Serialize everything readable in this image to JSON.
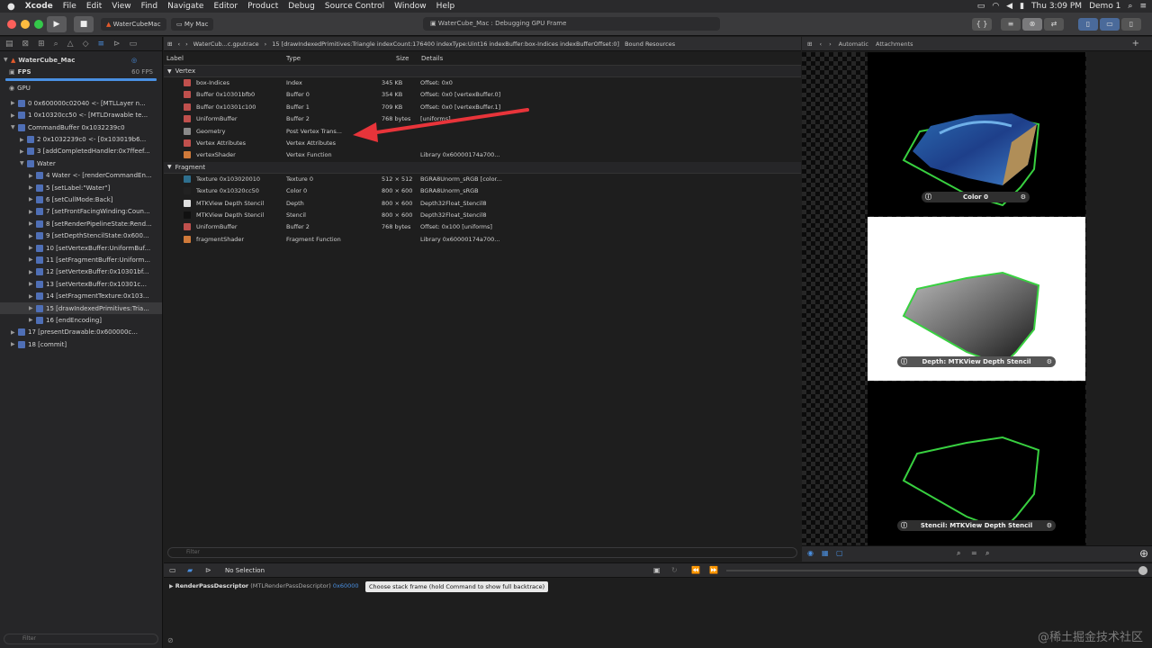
{
  "menubar": {
    "items": [
      "Xcode",
      "File",
      "Edit",
      "View",
      "Find",
      "Navigate",
      "Editor",
      "Product",
      "Debug",
      "Source Control",
      "Window",
      "Help"
    ],
    "clock": "Thu 3:09 PM",
    "user": "Demo 1"
  },
  "toolbar": {
    "scheme": "WaterCubeMac",
    "destination": "My Mac",
    "activity": "WaterCube_Mac : Debugging GPU Frame"
  },
  "navigator": {
    "project": "WaterCube_Mac",
    "fps_label": "FPS",
    "fps_value": "60 FPS",
    "gpu_label": "GPU",
    "filter_placeholder": "Filter",
    "items": [
      {
        "label": "0 0x600000c02040 <- [MTLLayer n...",
        "level": 1,
        "tri": "▶"
      },
      {
        "label": "1 0x10320cc50 <- [MTLDrawable te...",
        "level": 1,
        "tri": "▶"
      },
      {
        "label": "CommandBuffer 0x1032239c0",
        "level": 1,
        "tri": "▼"
      },
      {
        "label": "2 0x1032239c0 <- [0x103019b6...",
        "level": 2,
        "tri": "▶"
      },
      {
        "label": "3 [addCompletedHandler:0x7ffeef...",
        "level": 2,
        "tri": "▶"
      },
      {
        "label": "Water",
        "level": 2,
        "tri": "▼"
      },
      {
        "label": "4 Water <- [renderCommandEn...",
        "level": 3,
        "tri": "▶"
      },
      {
        "label": "5 [setLabel:\"Water\"]",
        "level": 3,
        "tri": "▶"
      },
      {
        "label": "6 [setCullMode:Back]",
        "level": 3,
        "tri": "▶"
      },
      {
        "label": "7 [setFrontFacingWinding:Coun...",
        "level": 3,
        "tri": "▶"
      },
      {
        "label": "8 [setRenderPipelineState:Rend...",
        "level": 3,
        "tri": "▶"
      },
      {
        "label": "9 [setDepthStencilState:0x600...",
        "level": 3,
        "tri": "▶"
      },
      {
        "label": "10 [setVertexBuffer:UniformBuf...",
        "level": 3,
        "tri": "▶"
      },
      {
        "label": "11 [setFragmentBuffer:Uniform...",
        "level": 3,
        "tri": "▶"
      },
      {
        "label": "12 [setVertexBuffer:0x10301bf...",
        "level": 3,
        "tri": "▶"
      },
      {
        "label": "13 [setVertexBuffer:0x10301c...",
        "level": 3,
        "tri": "▶"
      },
      {
        "label": "14 [setFragmentTexture:0x103...",
        "level": 3,
        "tri": "▶"
      },
      {
        "label": "15 [drawIndexedPrimitives:Tria...",
        "level": 3,
        "tri": "▶",
        "selected": true
      },
      {
        "label": "16 [endEncoding]",
        "level": 3,
        "tri": "▶"
      },
      {
        "label": "17 [presentDrawable:0x600000c...",
        "level": 1,
        "tri": "▶"
      },
      {
        "label": "18 [commit]",
        "level": 1,
        "tri": "▶"
      }
    ]
  },
  "jumpbar": {
    "file": "WaterCub...c.gputrace",
    "call": "15 [drawIndexedPrimitives:Triangle indexCount:176400 indexType:Uint16 indexBuffer:box-Indices indexBufferOffset:0]",
    "bound": "Bound Resources"
  },
  "table": {
    "headers": {
      "label": "Label",
      "type": "Type",
      "size": "Size",
      "details": "Details"
    },
    "vertex_section": "Vertex",
    "fragment_section": "Fragment",
    "vertex_rows": [
      {
        "label": "box-Indices",
        "type": "Index",
        "size": "345 KB",
        "details": "Offset: 0x0",
        "color": "#c0504d"
      },
      {
        "label": "Buffer 0x10301bfb0",
        "type": "Buffer 0",
        "size": "354 KB",
        "details": "Offset: 0x0 [vertexBuffer.0]",
        "color": "#c0504d"
      },
      {
        "label": "Buffer 0x10301c100",
        "type": "Buffer 1",
        "size": "709 KB",
        "details": "Offset: 0x0 [vertexBuffer.1]",
        "color": "#c0504d"
      },
      {
        "label": "UniformBuffer",
        "type": "Buffer 2",
        "size": "768 bytes",
        "details": "[uniforms]",
        "color": "#c0504d"
      },
      {
        "label": "Geometry",
        "type": "Post Vertex Trans...",
        "size": "",
        "details": "",
        "color": "#8a8a8a"
      },
      {
        "label": "Vertex Attributes",
        "type": "Vertex Attributes",
        "size": "",
        "details": "",
        "color": "#c0504d"
      },
      {
        "label": "vertexShader",
        "type": "Vertex Function",
        "size": "",
        "details": "Library 0x60000174a700...",
        "color": "#d07a3a"
      }
    ],
    "fragment_rows": [
      {
        "label": "Texture 0x103020010",
        "type": "Texture 0",
        "size": "512 × 512",
        "details": "BGRA8Unorm_sRGB [color...",
        "color": "#2e6f8e"
      },
      {
        "label": "Texture 0x10320cc50",
        "type": "Color 0",
        "size": "800 × 600",
        "details": "BGRA8Unorm_sRGB",
        "color": "#222222"
      },
      {
        "label": "MTKView Depth Stencil",
        "type": "Depth",
        "size": "800 × 600",
        "details": "Depth32Float_Stencil8",
        "color": "#e0e0e0"
      },
      {
        "label": "MTKView Depth Stencil",
        "type": "Stencil",
        "size": "800 × 600",
        "details": "Depth32Float_Stencil8",
        "color": "#111111"
      },
      {
        "label": "UniformBuffer",
        "type": "Buffer 2",
        "size": "768 bytes",
        "details": "Offset: 0x100 [uniforms]",
        "color": "#c0504d"
      },
      {
        "label": "fragmentShader",
        "type": "Fragment Function",
        "size": "",
        "details": "Library 0x60000174a700...",
        "color": "#d07a3a"
      }
    ],
    "filter_placeholder": "Filter"
  },
  "attachments": {
    "mode": "Automatic",
    "title": "Attachments",
    "color_label": "Color 0",
    "depth_label": "Depth: MTKView Depth Stencil",
    "stencil_label": "Stencil: MTKView Depth Stencil"
  },
  "debug": {
    "selection": "No Selection",
    "variable_name": "RenderPassDescriptor",
    "variable_type": "(MTLRenderPassDescriptor)",
    "variable_value": "0x60000",
    "tooltip": "Choose stack frame (hold Command to show full backtrace)"
  },
  "watermark": "@稀土掘金技术社区"
}
